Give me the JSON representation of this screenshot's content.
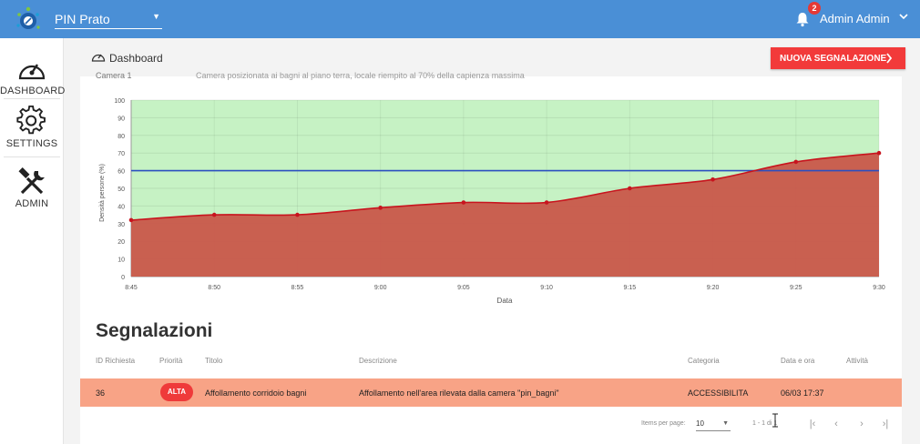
{
  "header": {
    "project_name": "PIN Prato",
    "notification_count": "2",
    "user_name": "Admin Admin"
  },
  "sidebar": {
    "items": [
      {
        "label": "DASHBOARD",
        "icon": "gauge-icon"
      },
      {
        "label": "SETTINGS",
        "icon": "gear-icon"
      },
      {
        "label": "ADMIN",
        "icon": "tools-icon"
      }
    ]
  },
  "breadcrumb": {
    "label": "Dashboard"
  },
  "actions": {
    "new_report_label": "NUOVA SEGNALAZIONE"
  },
  "camera_header": {
    "label": "Camera 1",
    "description": "Camera posizionata ai bagni al piano terra, locale riempito al 70% della capienza massima"
  },
  "colors": {
    "topbar": "#4a8fd6",
    "accent_red": "#f23a3a",
    "row_highlight": "#f8a386",
    "green_zone": "#c6f2c4",
    "density_fill": "#c9574a",
    "density_line": "#c8141e",
    "threshold_line": "#2a4fc0"
  },
  "chart_data": {
    "type": "area",
    "xlabel": "Data",
    "ylabel": "Densità persone (%)",
    "ylim": [
      0,
      100
    ],
    "yticks": [
      0,
      10,
      20,
      30,
      40,
      50,
      60,
      70,
      80,
      90,
      100
    ],
    "x": [
      "8:45",
      "8:50",
      "8:55",
      "9:00",
      "9:05",
      "9:10",
      "9:15",
      "9:20",
      "9:25",
      "9:30"
    ],
    "series": [
      {
        "values": [
          32,
          35,
          35,
          39,
          42,
          42,
          50,
          55,
          65,
          70
        ]
      }
    ],
    "threshold": 60,
    "grid": true
  },
  "reports": {
    "title": "Segnalazioni",
    "columns": [
      "ID Richiesta",
      "Priorità",
      "Titolo",
      "Descrizione",
      "Categoria",
      "Data e ora",
      "Attività"
    ],
    "rows": [
      {
        "id": "36",
        "priority": "ALTA",
        "title": "Affollamento corridoio bagni",
        "description": "Affollamento nell'area rilevata dalla camera \"pin_bagni\"",
        "category": "ACCESSIBILITA",
        "datetime": "06/03 17:37"
      }
    ]
  },
  "pagination": {
    "items_per_page_label": "Items per page:",
    "items_per_page": "10",
    "range": "1 - 1 di 1"
  }
}
